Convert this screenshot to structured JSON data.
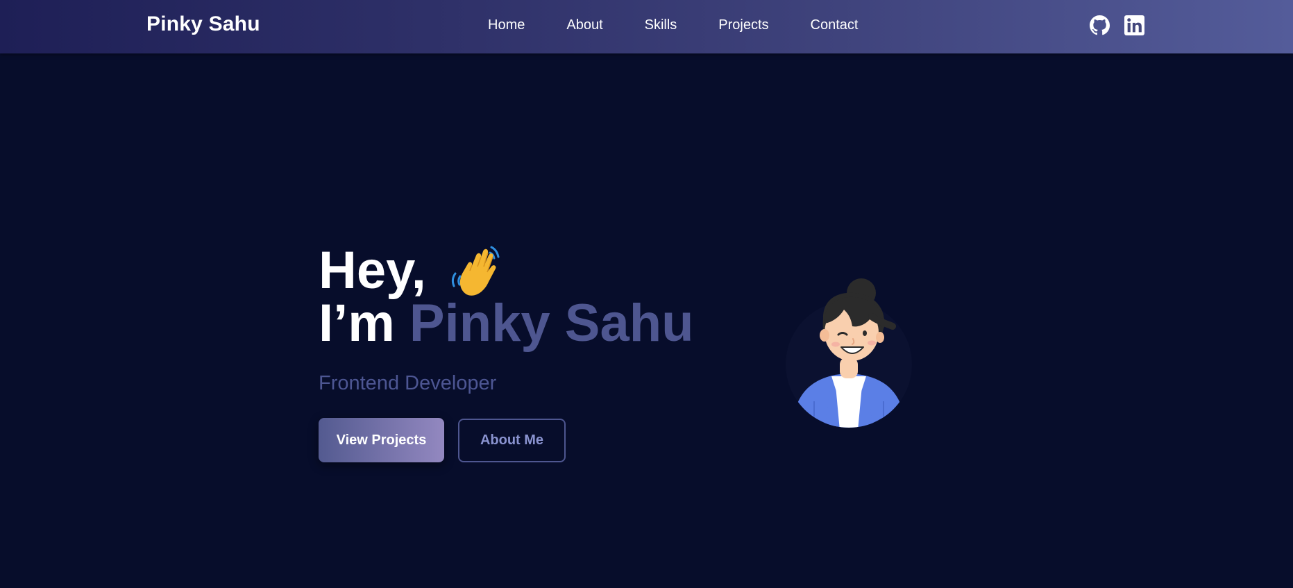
{
  "navbar": {
    "brand": "Pinky Sahu",
    "links": [
      {
        "label": "Home"
      },
      {
        "label": "About"
      },
      {
        "label": "Skills"
      },
      {
        "label": "Projects"
      },
      {
        "label": "Contact"
      }
    ],
    "social": [
      {
        "icon": "github-icon"
      },
      {
        "icon": "linkedin-icon"
      }
    ]
  },
  "hero": {
    "greeting": "Hey,",
    "greeting_icon": "waving-hand-icon",
    "intro_prefix": "I’m ",
    "name": "Pinky Sahu",
    "role": "Frontend Developer",
    "primary_button": "View Projects",
    "secondary_button": "About Me",
    "avatar": "developer-avatar-illustration"
  },
  "colors": {
    "background": "#070d2b",
    "accent": "#4e5690",
    "nav_gradient_start": "#1e1f56",
    "nav_gradient_end": "#545c9a",
    "button_gradient_end": "#9388c0"
  }
}
